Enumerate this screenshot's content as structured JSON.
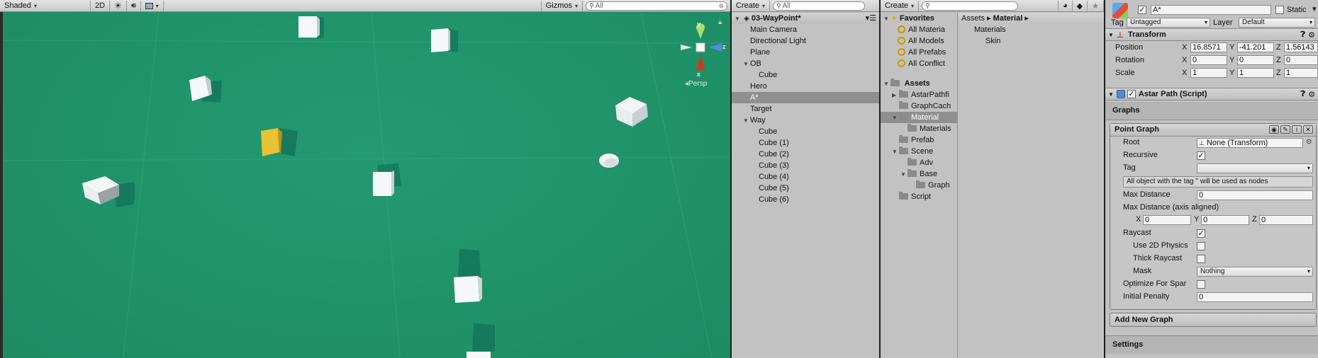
{
  "scene": {
    "shading_mode": "Shaded",
    "mode_2d": "2D",
    "gizmos": "Gizmos",
    "search_placeholder": "All",
    "gizmo_y": "y",
    "gizmo_z": "z",
    "gizmo_x": "x",
    "persp": "Persp"
  },
  "hierarchy": {
    "create": "Create",
    "search_placeholder": "All",
    "scene_name": "03-WayPoint*",
    "items": [
      {
        "label": "Main Camera",
        "indent": 1,
        "fold": ""
      },
      {
        "label": "Directional Light",
        "indent": 1,
        "fold": ""
      },
      {
        "label": "Plane",
        "indent": 1,
        "fold": ""
      },
      {
        "label": "OB",
        "indent": 1,
        "fold": "▼"
      },
      {
        "label": "Cube",
        "indent": 2,
        "fold": ""
      },
      {
        "label": "Hero",
        "indent": 1,
        "fold": ""
      },
      {
        "label": "A*",
        "indent": 1,
        "fold": "",
        "selected": true
      },
      {
        "label": "Target",
        "indent": 1,
        "fold": ""
      },
      {
        "label": "Way",
        "indent": 1,
        "fold": "▼"
      },
      {
        "label": "Cube",
        "indent": 2,
        "fold": ""
      },
      {
        "label": "Cube (1)",
        "indent": 2,
        "fold": ""
      },
      {
        "label": "Cube (2)",
        "indent": 2,
        "fold": ""
      },
      {
        "label": "Cube (3)",
        "indent": 2,
        "fold": ""
      },
      {
        "label": "Cube (4)",
        "indent": 2,
        "fold": ""
      },
      {
        "label": "Cube (5)",
        "indent": 2,
        "fold": ""
      },
      {
        "label": "Cube (6)",
        "indent": 2,
        "fold": ""
      }
    ]
  },
  "project": {
    "create": "Create",
    "favorites": "Favorites",
    "favorite_items": [
      "All Materia",
      "All Models",
      "All Prefabs",
      "All Conflict"
    ],
    "assets": "Assets",
    "asset_tree": [
      {
        "label": "AstarPathfi",
        "indent": 1,
        "fold": "▶"
      },
      {
        "label": "GraphCach",
        "indent": 1,
        "fold": ""
      },
      {
        "label": "Material",
        "indent": 1,
        "fold": "▼",
        "selected": true
      },
      {
        "label": "Materials",
        "indent": 2,
        "fold": ""
      },
      {
        "label": "Prefab",
        "indent": 1,
        "fold": ""
      },
      {
        "label": "Scene",
        "indent": 1,
        "fold": "▼"
      },
      {
        "label": "Adv",
        "indent": 2,
        "fold": ""
      },
      {
        "label": "Base",
        "indent": 2,
        "fold": "▼"
      },
      {
        "label": "Graph",
        "indent": 3,
        "fold": ""
      },
      {
        "label": "Script",
        "indent": 1,
        "fold": ""
      }
    ],
    "breadcrumb_root": "Assets",
    "breadcrumb_sep": "▸",
    "breadcrumb_current": "Material",
    "content_items": [
      {
        "label": "Materials",
        "folder": true
      },
      {
        "label": "Skin",
        "folder": false
      }
    ]
  },
  "inspector": {
    "object_name": "A*",
    "static_label": "Static",
    "tag_label": "Tag",
    "tag_value": "Untagged",
    "layer_label": "Layer",
    "layer_value": "Default",
    "transform": {
      "title": "Transform",
      "position_label": "Position",
      "position": {
        "x": "16.8571",
        "y": "-41.201",
        "z": "1.56143"
      },
      "rotation_label": "Rotation",
      "rotation": {
        "x": "0",
        "y": "0",
        "z": "0"
      },
      "scale_label": "Scale",
      "scale": {
        "x": "1",
        "y": "1",
        "z": "1"
      },
      "axis_x": "X",
      "axis_y": "Y",
      "axis_z": "Z"
    },
    "astar": {
      "title": "Astar Path (Script)",
      "graphs_label": "Graphs",
      "point_graph": "Point Graph",
      "root_label": "Root",
      "root_value": "None (Transform)",
      "recursive_label": "Recursive",
      "tag_label": "Tag",
      "tag_value": "",
      "tag_info": "All object with the tag '' will be used as nodes",
      "max_distance_label": "Max Distance",
      "max_distance_value": "0",
      "max_distance_axis_label": "Max Distance (axis aligned)",
      "max_axis": {
        "x": "0",
        "y": "0",
        "z": "0"
      },
      "raycast_label": "Raycast",
      "use2d_label": "Use 2D Physics",
      "thick_label": "Thick Raycast",
      "mask_label": "Mask",
      "mask_value": "Nothing",
      "optimize_label": "Optimize For Spar",
      "penalty_label": "Initial Penalty",
      "penalty_value": "0",
      "add_graph": "Add New Graph",
      "settings": "Settings"
    }
  }
}
